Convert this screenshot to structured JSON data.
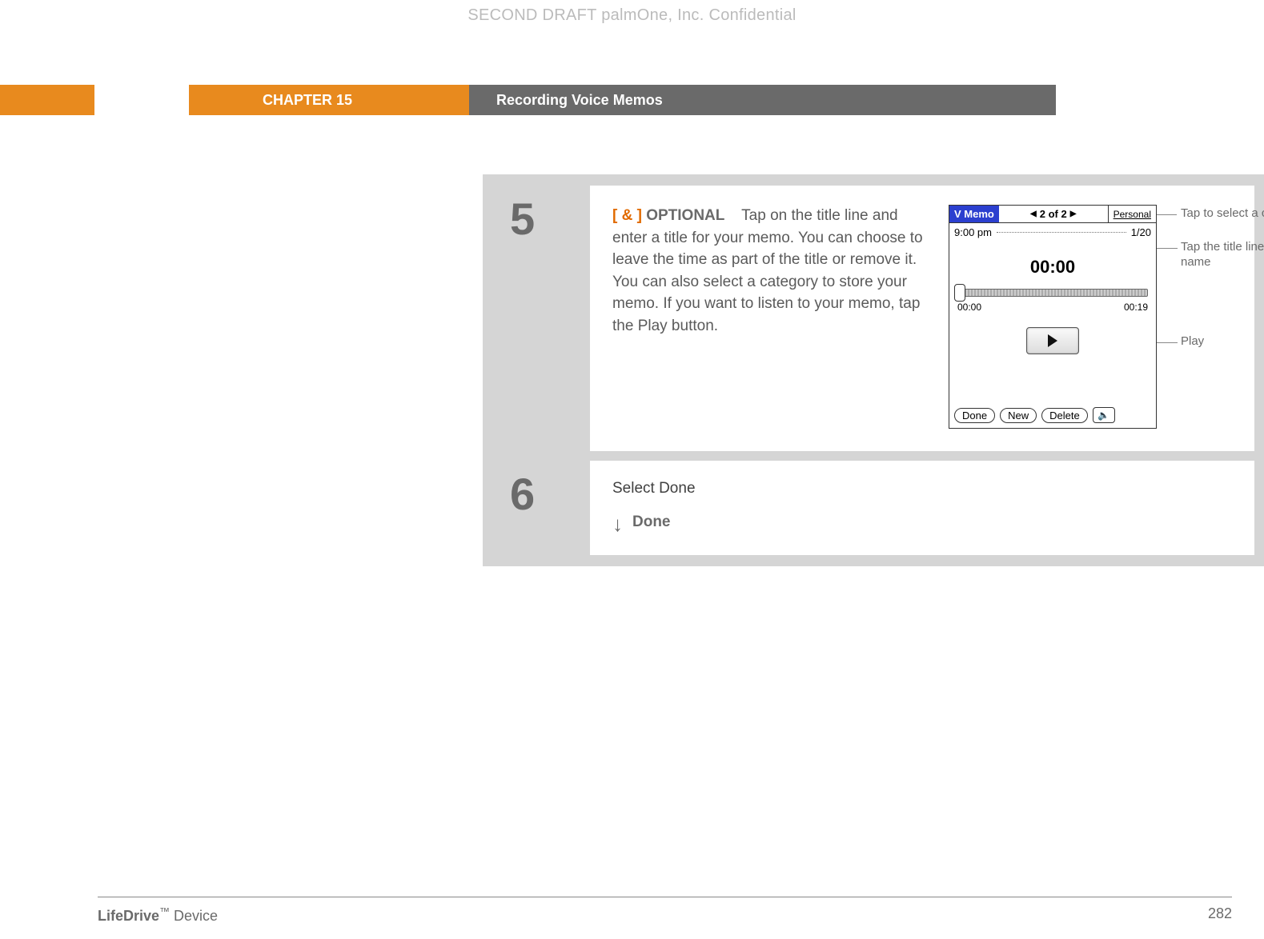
{
  "watermark": "SECOND DRAFT palmOne, Inc.  Confidential",
  "header": {
    "chapter": "CHAPTER 15",
    "section": "Recording Voice Memos"
  },
  "step5": {
    "num": "5",
    "prefix": "[ & ]",
    "optional": "OPTIONAL",
    "body": "Tap on the title line and enter a title for your memo. You can choose to leave the time as part of the title or remove it. You can also select a category to store your memo. If you want to listen to your memo, tap the Play button.",
    "palm": {
      "app": "V Memo",
      "nav": "2 of 2",
      "category": "Personal",
      "title_time": "9:00 pm",
      "title_date": "1/20",
      "timer": "00:00",
      "t_start": "00:00",
      "t_end": "00:19",
      "buttons": {
        "done": "Done",
        "new": "New",
        "delete": "Delete"
      }
    },
    "callouts": {
      "cat": "Tap to select a category",
      "title": "Tap the title line and enter a name",
      "play": "Play"
    }
  },
  "step6": {
    "num": "6",
    "body": "Select Done",
    "done": "Done"
  },
  "footer": {
    "product_bold": "LifeDrive",
    "product_tm": "™",
    "product_rest": "Device",
    "page": "282"
  }
}
